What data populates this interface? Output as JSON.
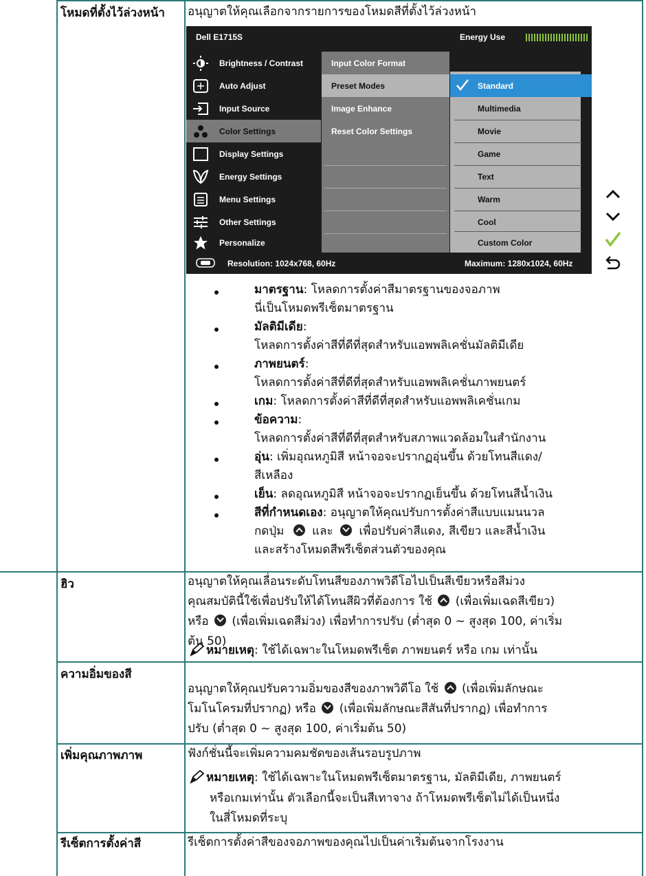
{
  "preset": {
    "label": "โหมดที่ตั้งไว้ล่วงหน้า",
    "desc": "อนุญาตให้คุณเลือกจากรายการของโหมดสีที่ตั้งไว้ล่วงหน้า"
  },
  "osd": {
    "model": "Dell E1715S",
    "energy_label": "Energy Use",
    "menu": [
      {
        "label": "Brightness / Contrast",
        "icon": "brightness-icon"
      },
      {
        "label": "Auto Adjust",
        "icon": "auto-adjust-icon"
      },
      {
        "label": "Input Source",
        "icon": "input-source-icon"
      },
      {
        "label": "Color Settings",
        "icon": "color-settings-icon",
        "selected": true
      },
      {
        "label": "Display Settings",
        "icon": "display-settings-icon"
      },
      {
        "label": "Energy Settings",
        "icon": "energy-leaf-icon"
      },
      {
        "label": "Menu Settings",
        "icon": "menu-settings-icon"
      },
      {
        "label": "Other Settings",
        "icon": "sliders-icon"
      },
      {
        "label": "Personalize",
        "icon": "star-icon"
      }
    ],
    "color_menu": [
      "Input Color Format",
      "Preset Modes",
      "Image Enhance",
      "Reset Color Settings"
    ],
    "modes": [
      "Standard",
      "Multimedia",
      "Movie",
      "Game",
      "Text",
      "Warm",
      "Cool",
      "Custom Color"
    ],
    "selected_mode": "Standard",
    "resolution": "Resolution: 1024x768, 60Hz",
    "maximum": "Maximum: 1280x1024, 60Hz"
  },
  "bullets": [
    {
      "term": "มาตรฐาน",
      "text": ": โหลดการตั้งค่าสีมาตรฐานของจอภาพ",
      "text2": "นี่เป็นโหมดพรีเซ็ตมาตรฐาน"
    },
    {
      "term": "มัลติมีเดีย",
      "text": ":",
      "text2": "โหลดการตั้งค่าสีที่ดีที่สุดสำหรับแอพพลิเคชั่นมัลติมีเดีย"
    },
    {
      "term": "ภาพยนตร์",
      "text": ":",
      "text2": "โหลดการตั้งค่าสีที่ดีที่สุดสำหรับแอพพลิเคชั่นภาพยนตร์"
    },
    {
      "term": "เกม",
      "text": ": โหลดการตั้งค่าสีที่ดีที่สุดสำหรับแอพพลิเคชั่นเกม"
    },
    {
      "term": "ข้อความ",
      "text": ":",
      "text2": "โหลดการตั้งค่าสีที่ดีที่สุดสำหรับสภาพแวดล้อมในสำนักงาน"
    },
    {
      "term": "อุ่น",
      "text": ": เพิ่มอุณหภูมิสี หน้าจอจะปรากฏอุ่นขึ้น ด้วยโทนสีแดง/",
      "text2": "สีเหลือง"
    },
    {
      "term": "เย็น",
      "text": ": ลดอุณหภูมิสี หน้าจอจะปรากฏเย็นขึ้น ด้วยโทนสีน้ำเงิน"
    },
    {
      "term": "สีที่กำหนดเอง",
      "text": ": อนุญาตให้คุณปรับการตั้งค่าสีแบบแมนนวล"
    }
  ],
  "custom": {
    "line2a": "กดปุ่ม",
    "line2b": "และ",
    "line2c": "เพื่อปรับค่าสีแดง, สีเขียว และสีน้ำเงิน",
    "line3": "และสร้างโหมดสีพรีเซ็ตส่วนตัวของคุณ"
  },
  "hue": {
    "label": "ฮิว",
    "l1": "อนุญาตให้คุณเลื่อนระดับโทนสีของภาพวิดีโอไปเป็นสีเขียวหรือสีม่วง",
    "l2a": "คุณสมบัตินี้ใช้เพื่อปรับให้ได้โทนสีผิวที่ต้องการ ใช้",
    "l2b": "(เพื่อเพิ่มเฉดสีเขียว)",
    "l3a": "หรือ",
    "l3b": "(เพื่อเพิ่มเฉดสีม่วง) เพื่อทำการปรับ (ต่ำสุด 0 ~ สูงสุด 100, ค่าเริ่ม",
    "l4": "ต้น 50)",
    "note_label": "หมายเหตุ",
    "note": ": ใช้ได้เฉพาะในโหมดพรีเซ็ต ภาพยนตร์ หรือ เกม เท่านั้น"
  },
  "saturation": {
    "label": "ความอิ่มของสี",
    "l1a": "อนุญาตให้คุณปรับความอิ่มของสีของภาพวิดีโอ ใช้",
    "l1b": "(เพื่อเพิ่มลักษณะ",
    "l2a": "โมโนโครมที่ปรากฏ) หรือ",
    "l2b": "(เพื่อเพิ่มลักษณะสีสันที่ปรากฏ) เพื่อทำการ",
    "l3": "ปรับ (ต่ำสุด 0 ~ สูงสุด 100, ค่าเริ่มต้น 50)"
  },
  "enhance": {
    "label": "เพิ่มคุณภาพภาพ",
    "l1": "ฟังก์ชั่นนี้จะเพิ่มความคมชัดของเส้นรอบรูปภาพ",
    "note_label": "หมายเหตุ",
    "note": ": ใช้ได้เฉพาะในโหมดพรีเซ็ตมาตรฐาน, มัลติมีเดีย, ภาพยนตร์",
    "l2": "หรือเกมเท่านั้น ตัวเลือกนี้จะเป็นสีเทาจาง ถ้าโหมดพรีเซ็ตไม่ได้เป็นหนึ่ง",
    "l3": "ในสี่โหมดที่ระบุ"
  },
  "reset": {
    "label": "รีเซ็ตการตั้งค่าสี",
    "l1": "รีเซ็ตการตั้งค่าสีของจอภาพของคุณไปเป็นค่าเริ่มต้นจากโรงงาน"
  },
  "side_buttons": [
    "up-icon",
    "down-icon",
    "check-icon",
    "back-icon"
  ],
  "colors": {
    "rule": "#2a7a7a",
    "osd_bg": "#1c1c1c",
    "osd_sel": "#7a7a7a",
    "osd_light": "#b4b4b4",
    "accent": "#2c8fd3",
    "check": "#8dc63f"
  }
}
